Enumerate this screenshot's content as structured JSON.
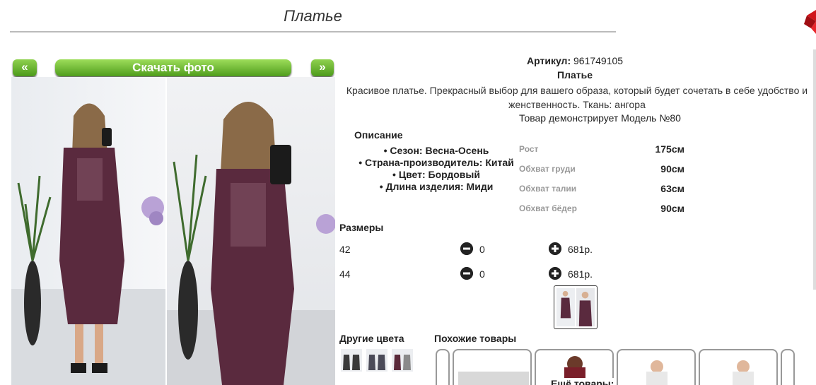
{
  "title": "Платье",
  "gallery": {
    "prev_label": "«",
    "next_label": "»",
    "download_label": "Скачать фото"
  },
  "product": {
    "article_label": "Артикул:",
    "article_value": "961749105",
    "name": "Платье",
    "description": "Красивое платье. Прекрасный выбор для вашего образа, который будет сочетать в себе удобство и женственность. Ткань: ангора",
    "model_note": "Товар демонстрирует Модель №80"
  },
  "specs": {
    "heading": "Описание",
    "items": [
      "Сезон: Весна-Осень",
      "Страна-производитель: Китай",
      "Цвет: Бордовый",
      "Длина изделия: Миди"
    ]
  },
  "model_params": [
    {
      "label": "Рост",
      "value": "175см"
    },
    {
      "label": "Обхват груди",
      "value": "90см"
    },
    {
      "label": "Обхват талии",
      "value": "63см"
    },
    {
      "label": "Обхват бёдер",
      "value": "90см"
    }
  ],
  "sizes": {
    "heading": "Размеры",
    "rows": [
      {
        "size": "42",
        "qty": "0",
        "price": "681р."
      },
      {
        "size": "44",
        "qty": "0",
        "price": "681р."
      }
    ]
  },
  "other_colors_heading": "Другие цвета",
  "similar_heading": "Похожие товары",
  "more_label": "Ещё товары:",
  "colors": {
    "accent_green": "#5aa822",
    "dress": "#5a2a3e"
  }
}
